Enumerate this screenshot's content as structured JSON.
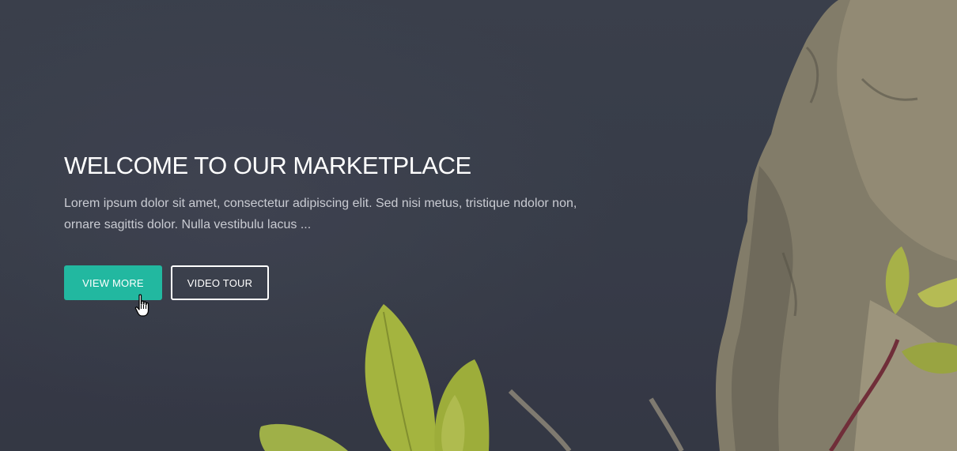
{
  "hero": {
    "title": "WELCOME TO OUR MARKETPLACE",
    "description": "Lorem ipsum dolor sit amet, consectetur adipiscing elit. Sed nisi metus, tristique ndolor non, ornare sagittis dolor. Nulla vestibulu lacus ...",
    "buttons": {
      "primary_label": "VIEW MORE",
      "secondary_label": "VIDEO TOUR"
    }
  },
  "colors": {
    "accent": "#22b8a0",
    "background": "#3b3f4c",
    "title": "#ffffff",
    "text": "#c9cbd2"
  },
  "icons": {
    "cursor": "hand-pointer-icon"
  }
}
